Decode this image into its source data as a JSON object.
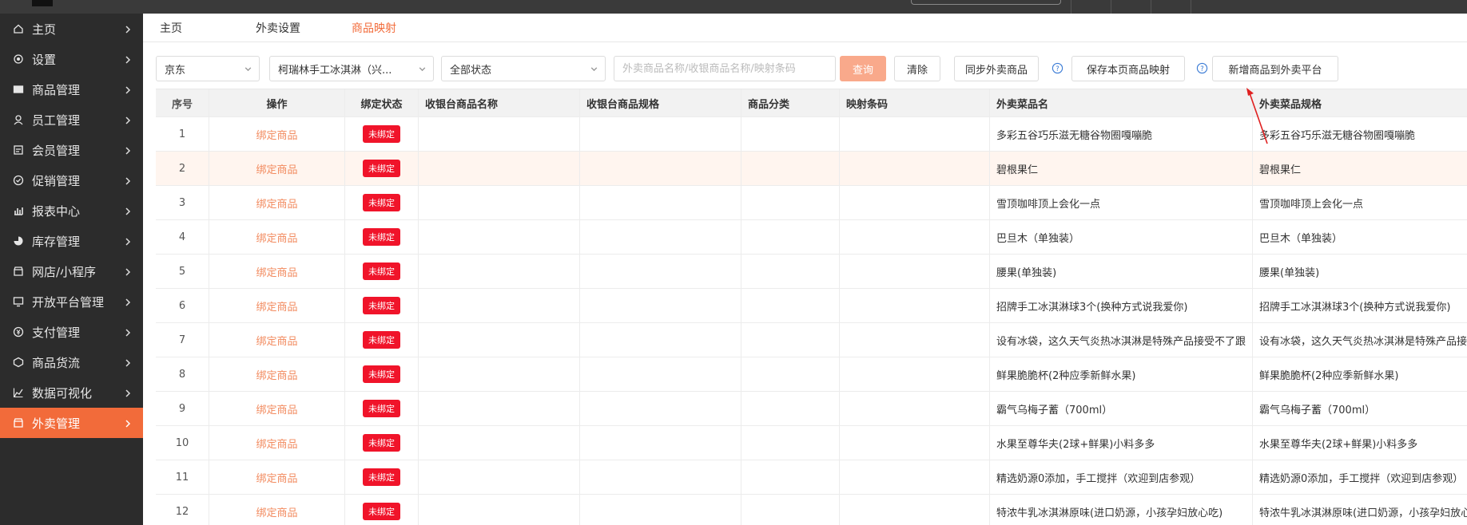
{
  "sidebar": {
    "items": [
      {
        "label": "主页",
        "icon": "home-icon"
      },
      {
        "label": "设置",
        "icon": "settings-icon"
      },
      {
        "label": "商品管理",
        "icon": "goods-icon"
      },
      {
        "label": "员工管理",
        "icon": "staff-icon"
      },
      {
        "label": "会员管理",
        "icon": "member-icon"
      },
      {
        "label": "促销管理",
        "icon": "promo-icon"
      },
      {
        "label": "报表中心",
        "icon": "report-icon"
      },
      {
        "label": "库存管理",
        "icon": "inventory-icon"
      },
      {
        "label": "网店/小程序",
        "icon": "shop-icon"
      },
      {
        "label": "开放平台管理",
        "icon": "platform-icon"
      },
      {
        "label": "支付管理",
        "icon": "payment-icon"
      },
      {
        "label": "商品货流",
        "icon": "logistics-icon"
      },
      {
        "label": "数据可视化",
        "icon": "chart-icon"
      },
      {
        "label": "外卖管理",
        "icon": "delivery-icon"
      }
    ]
  },
  "tabs": [
    {
      "label": "主页"
    },
    {
      "label": "外卖设置"
    },
    {
      "label": "商品映射"
    }
  ],
  "filters": {
    "platform": "京东",
    "store": "柯瑞林手工冰淇淋（兴...",
    "status": "全部状态",
    "search_placeholder": "外卖商品名称/收银商品名称/映射条码",
    "query_button": "查询",
    "clear_button": "清除",
    "sync_button": "同步外卖商品",
    "save_button": "保存本页商品映射",
    "add_button": "新增商品到外卖平台"
  },
  "table": {
    "headers": [
      "序号",
      "操作",
      "绑定状态",
      "收银台商品名称",
      "收银台商品规格",
      "商品分类",
      "映射条码",
      "外卖菜品名",
      "外卖菜品规格"
    ],
    "rows": [
      {
        "idx": "1",
        "op": "绑定商品",
        "status": "未绑定",
        "tname": "多彩五谷巧乐滋无糖谷物圈嘎嘣脆",
        "tspec": "多彩五谷巧乐滋无糖谷物圈嘎嘣脆"
      },
      {
        "idx": "2",
        "op": "绑定商品",
        "status": "未绑定",
        "tname": "碧根果仁",
        "tspec": "碧根果仁"
      },
      {
        "idx": "3",
        "op": "绑定商品",
        "status": "未绑定",
        "tname": "雪顶咖啡顶上会化一点",
        "tspec": "雪顶咖啡顶上会化一点"
      },
      {
        "idx": "4",
        "op": "绑定商品",
        "status": "未绑定",
        "tname": "巴旦木（单独装）",
        "tspec": "巴旦木（单独装）"
      },
      {
        "idx": "5",
        "op": "绑定商品",
        "status": "未绑定",
        "tname": "腰果(单独装)",
        "tspec": "腰果(单独装)"
      },
      {
        "idx": "6",
        "op": "绑定商品",
        "status": "未绑定",
        "tname": "招牌手工冰淇淋球3个(换种方式说我爱你)",
        "tspec": "招牌手工冰淇淋球3个(换种方式说我爱你)"
      },
      {
        "idx": "7",
        "op": "绑定商品",
        "status": "未绑定",
        "tname": "设有冰袋，这久天气炎热冰淇淋是特殊产品接受不了跟",
        "tspec": "设有冰袋，这久天气炎热冰淇淋是特殊产品接"
      },
      {
        "idx": "8",
        "op": "绑定商品",
        "status": "未绑定",
        "tname": "鲜果脆脆杯(2种应季新鲜水果)",
        "tspec": "鲜果脆脆杯(2种应季新鲜水果)"
      },
      {
        "idx": "9",
        "op": "绑定商品",
        "status": "未绑定",
        "tname": "霸气乌梅子蓄（700ml）",
        "tspec": "霸气乌梅子蓄（700ml）"
      },
      {
        "idx": "10",
        "op": "绑定商品",
        "status": "未绑定",
        "tname": "水果至尊华夫(2球+鲜果)小料多多",
        "tspec": "水果至尊华夫(2球+鲜果)小料多多"
      },
      {
        "idx": "11",
        "op": "绑定商品",
        "status": "未绑定",
        "tname": "精选奶源0添加，手工搅拌（欢迎到店参观）",
        "tspec": "精选奶源0添加，手工搅拌（欢迎到店参观）"
      },
      {
        "idx": "12",
        "op": "绑定商品",
        "status": "未绑定",
        "tname": "特浓牛乳冰淇淋原味(进口奶源，小孩孕妇放心吃)",
        "tspec": "特浓牛乳冰淇淋原味(进口奶源，小孩孕妇放心"
      }
    ]
  },
  "colors": {
    "accent": "#f26b3a",
    "sidebar_bg": "#2c2c2c",
    "badge_red": "#f0142a",
    "link": "#f28a5e"
  }
}
